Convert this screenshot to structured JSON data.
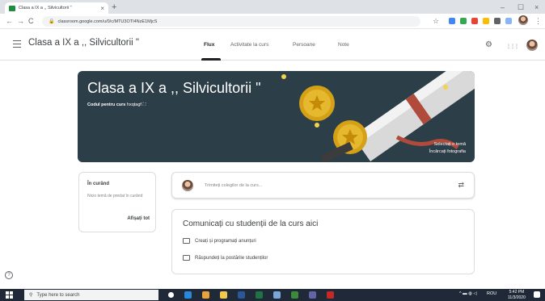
{
  "browser": {
    "tab_title": "Clasa a IX a ,, Silvicultorii \"",
    "url": "classroom.google.com/u/0/c/MTU3OTI4NzE1MjcS",
    "new_tab": "+",
    "tab_close": "×",
    "back": "←",
    "forward": "→",
    "reload": "C",
    "lock": "🔒",
    "bookmark": "☆",
    "minimize": "–",
    "maximize": "☐",
    "close": "×"
  },
  "app": {
    "class_title": "Clasa a IX a ,, Silvicultorii \"",
    "tabs": [
      {
        "label": "Flux",
        "active": true
      },
      {
        "label": "Activitate la curs",
        "active": false
      },
      {
        "label": "Persoane",
        "active": false
      },
      {
        "label": "Note",
        "active": false
      }
    ],
    "settings_icon": "⚙",
    "apps_icon": "⋮⋮⋮"
  },
  "banner": {
    "title": "Clasa a IX a ,, Silvicultorii \"",
    "code_label": "Codul pentru curs",
    "code_value": "hxqtagf",
    "fullscreen_icon": "⛶",
    "select_theme": "Selectați o temă",
    "upload_photo": "Încărcați fotografia"
  },
  "upcoming": {
    "title": "În curând",
    "text": "Nicio temă de predat în curând",
    "link": "Afișați tot"
  },
  "composer": {
    "placeholder": "Trimiteți colegilor de la curs...",
    "repost_icon": "⇄"
  },
  "communicate": {
    "title": "Comunicați cu studenții de la curs aici",
    "items": [
      "Creați și programați anunțuri",
      "Răspundeți la postările studenților"
    ]
  },
  "help_icon": "?",
  "taskbar": {
    "search_placeholder": "Type here to search",
    "tray_text": "ROU",
    "time": "5:42 PM",
    "date": "11/3/2020"
  },
  "colors": {
    "banner_bg": "#2c3e48",
    "accent": "#202124",
    "taskbar": "#1f2937"
  }
}
